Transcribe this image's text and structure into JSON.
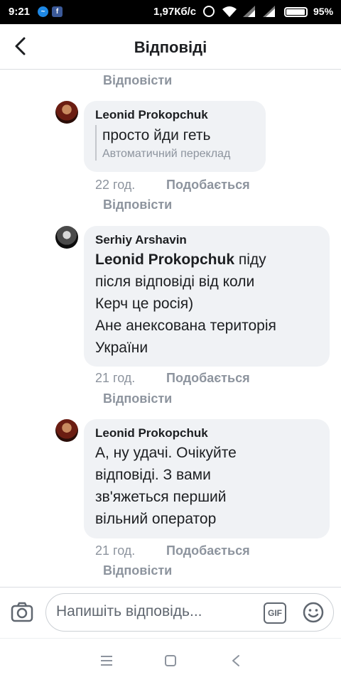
{
  "status_bar": {
    "time": "9:21",
    "speed": "1,97Кб/с",
    "battery_percent": "95%",
    "battery_level": 0.95
  },
  "header": {
    "title": "Відповіді"
  },
  "thread": {
    "top_reply_label": "Відповісти",
    "comments": [
      {
        "author": "Leonid Prokopchuk",
        "text": "просто йди геть",
        "translation_note": "Автоматичний переклад",
        "time": "22 год.",
        "like_label": "Подобається",
        "reply_label": "Відповісти"
      },
      {
        "author": "Serhiy Arshavin",
        "mention": "Leonid Prokopchuk",
        "text": "піду\nпісля відповіді від коли\nКерч це росія)\nАне анексована територія\nУкраїни",
        "time": "21 год.",
        "like_label": "Подобається",
        "reply_label": "Відповісти"
      },
      {
        "author": "Leonid Prokopchuk",
        "text": "А, ну удачі. Очікуйте\nвідповіді. З вами\nзв'яжеться перший\nвільний оператор",
        "time": "21 год.",
        "like_label": "Подобається",
        "reply_label": "Відповісти"
      }
    ]
  },
  "composer": {
    "placeholder": "Напишіть відповідь...",
    "gif_label": "GIF"
  },
  "icons": {
    "back": "arrow-left-icon",
    "camera": "camera-icon",
    "emoji": "smiley-icon",
    "nav_menu": "menu-icon",
    "nav_home": "square-icon",
    "nav_back": "triangle-back-icon"
  }
}
